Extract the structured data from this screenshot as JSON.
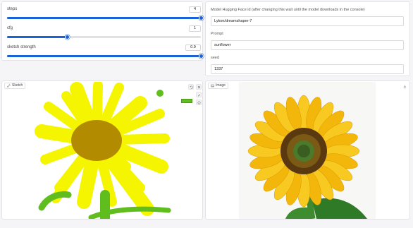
{
  "controls": {
    "steps": {
      "label": "steps",
      "value": "4",
      "fraction": 1.0
    },
    "cfg": {
      "label": "cfg",
      "value": "1",
      "fraction": 0.31
    },
    "sketch_strength": {
      "label": "sketch strength",
      "value": "0.9",
      "fraction": 1.0
    }
  },
  "inputs": {
    "model": {
      "label": "Model Hugging Face id (after changing this wait until the model downloads in the console)",
      "value": "Lykon/dreamshaper-7"
    },
    "prompt": {
      "label": "Prompt",
      "value": "sunflower"
    },
    "seed": {
      "label": "seed",
      "value": "1337"
    }
  },
  "sketch": {
    "tab_label": "Sketch",
    "brush_color": "#5fbe1e",
    "stroke_color": "#f5f500",
    "center_color": "#b38b00"
  },
  "image": {
    "tab_label": "Image"
  },
  "icons": [
    "pencil-icon",
    "image-icon",
    "undo-icon",
    "close-icon",
    "brush-icon",
    "palette-icon",
    "download-icon"
  ],
  "colors": {
    "accent": "#1a62d9",
    "panel_border": "#e3e3e7",
    "background": "#f5f5f7"
  }
}
